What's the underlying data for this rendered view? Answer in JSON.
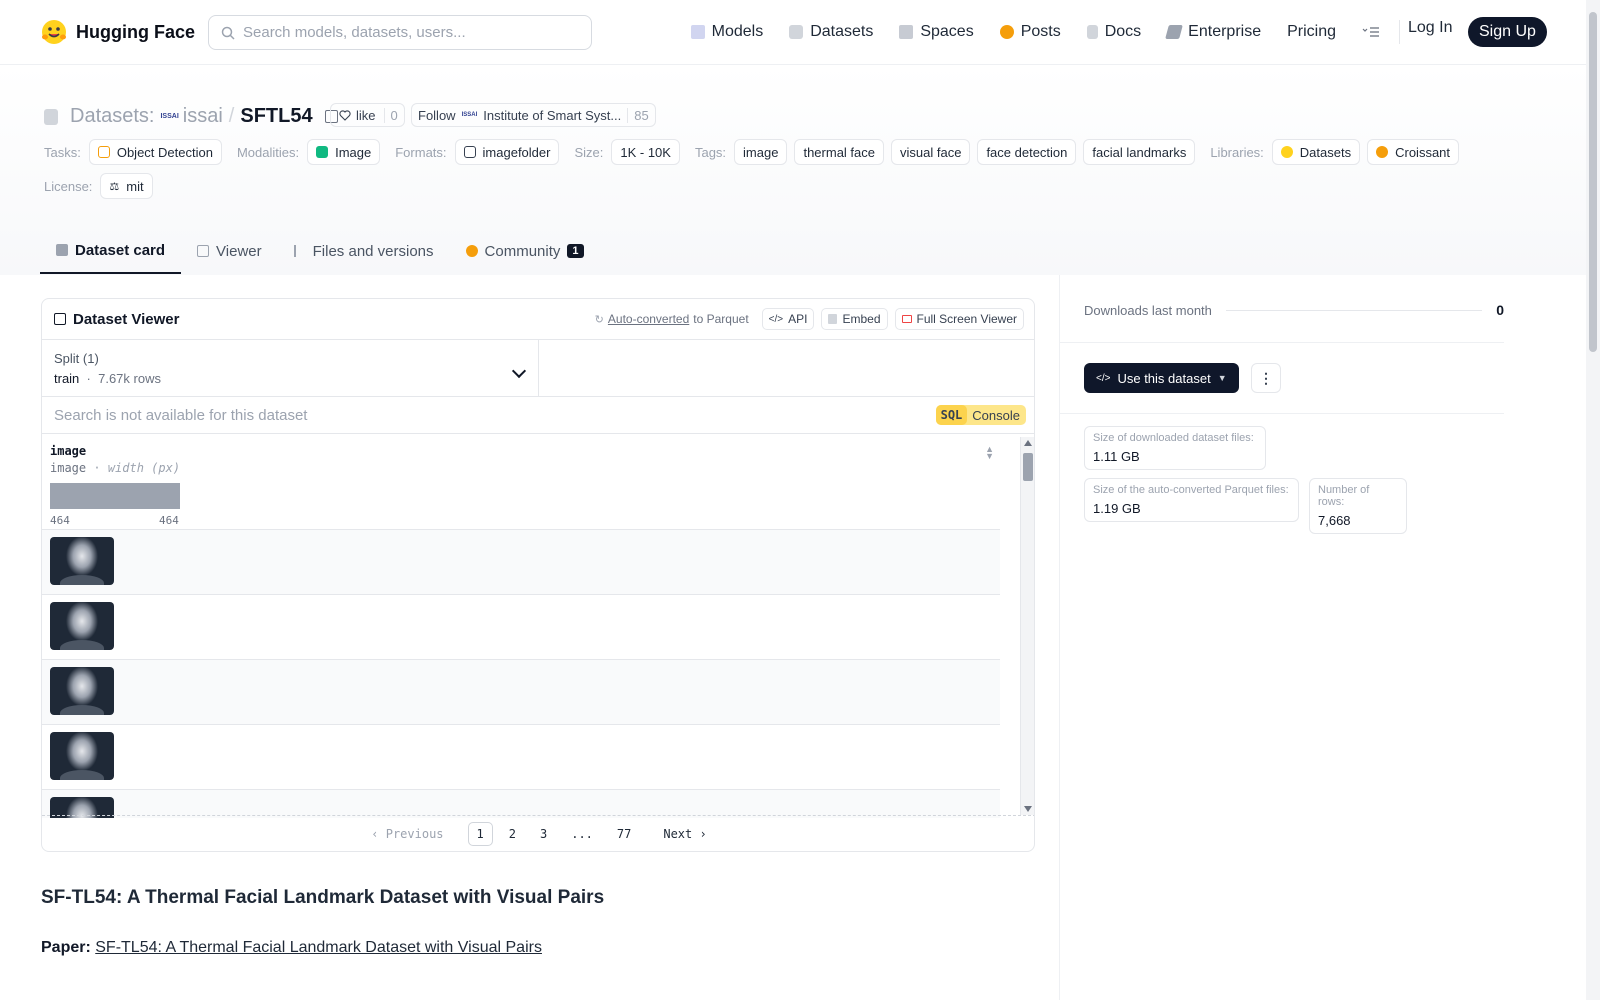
{
  "nav": {
    "brand": "Hugging Face",
    "search_placeholder": "Search models, datasets, users...",
    "links": [
      {
        "label": "Models",
        "icon": "cube-icon"
      },
      {
        "label": "Datasets",
        "icon": "database-icon"
      },
      {
        "label": "Spaces",
        "icon": "grid-icon"
      },
      {
        "label": "Posts",
        "icon": "chat-bubble-icon"
      },
      {
        "label": "Docs",
        "icon": "document-icon"
      },
      {
        "label": "Enterprise",
        "icon": "building-icon"
      },
      {
        "label": "Pricing",
        "icon": ""
      }
    ],
    "login": "Log In",
    "signup": "Sign Up"
  },
  "header": {
    "crumb_label": "Datasets:",
    "org": "issai",
    "org_logo": "ISSAI",
    "dataset_name": "SFTL54",
    "like_label": "like",
    "like_count": "0",
    "follow_label": "Follow",
    "follow_org": "Institute of Smart Syst...",
    "follow_count": "85",
    "tasks_label": "Tasks:",
    "task": "Object Detection",
    "modalities_label": "Modalities:",
    "modality": "Image",
    "formats_label": "Formats:",
    "format": "imagefolder",
    "size_label": "Size:",
    "size": "1K - 10K",
    "tags_label": "Tags:",
    "tags": [
      "image",
      "thermal face",
      "visual face",
      "face detection",
      "facial landmarks"
    ],
    "libraries_label": "Libraries:",
    "libraries": [
      "Datasets",
      "Croissant"
    ],
    "license_label": "License:",
    "license": "mit"
  },
  "tabs": [
    {
      "label": "Dataset card",
      "active": true
    },
    {
      "label": "Viewer",
      "active": false
    },
    {
      "label": "Files and versions",
      "active": false
    },
    {
      "label": "Community",
      "active": false,
      "badge": "1"
    }
  ],
  "viewer": {
    "title": "Dataset Viewer",
    "auto_converted": "Auto-converted",
    "to_parquet": "to Parquet",
    "api": "API",
    "embed": "Embed",
    "fullscreen": "Full Screen Viewer",
    "split_label": "Split (1)",
    "split_name": "train",
    "split_rows": "7.67k rows",
    "search_placeholder": "Search is not available for this dataset",
    "sql_badge": "SQL",
    "sql_label": "Console",
    "column_name": "image",
    "column_type": "image",
    "column_sub": "width (px)",
    "axis_min": "464",
    "axis_max": "464",
    "pager": {
      "prev": "Previous",
      "pages": [
        "1",
        "2",
        "3",
        "...",
        "77"
      ],
      "next": "Next"
    }
  },
  "readme": {
    "title": "SF-TL54: A Thermal Facial Landmark Dataset with Visual Pairs",
    "paper_label": "Paper:",
    "paper_link": "SF-TL54: A Thermal Facial Landmark Dataset with Visual Pairs"
  },
  "sidebar": {
    "downloads_label": "Downloads last month",
    "downloads_value": "0",
    "use_button": "Use this dataset",
    "stats": [
      {
        "key": "Size of downloaded dataset files:",
        "value": "1.11 GB"
      },
      {
        "key": "Size of the auto-converted Parquet files:",
        "value": "1.19 GB"
      },
      {
        "key": "Number of rows:",
        "value": "7,668"
      }
    ]
  }
}
